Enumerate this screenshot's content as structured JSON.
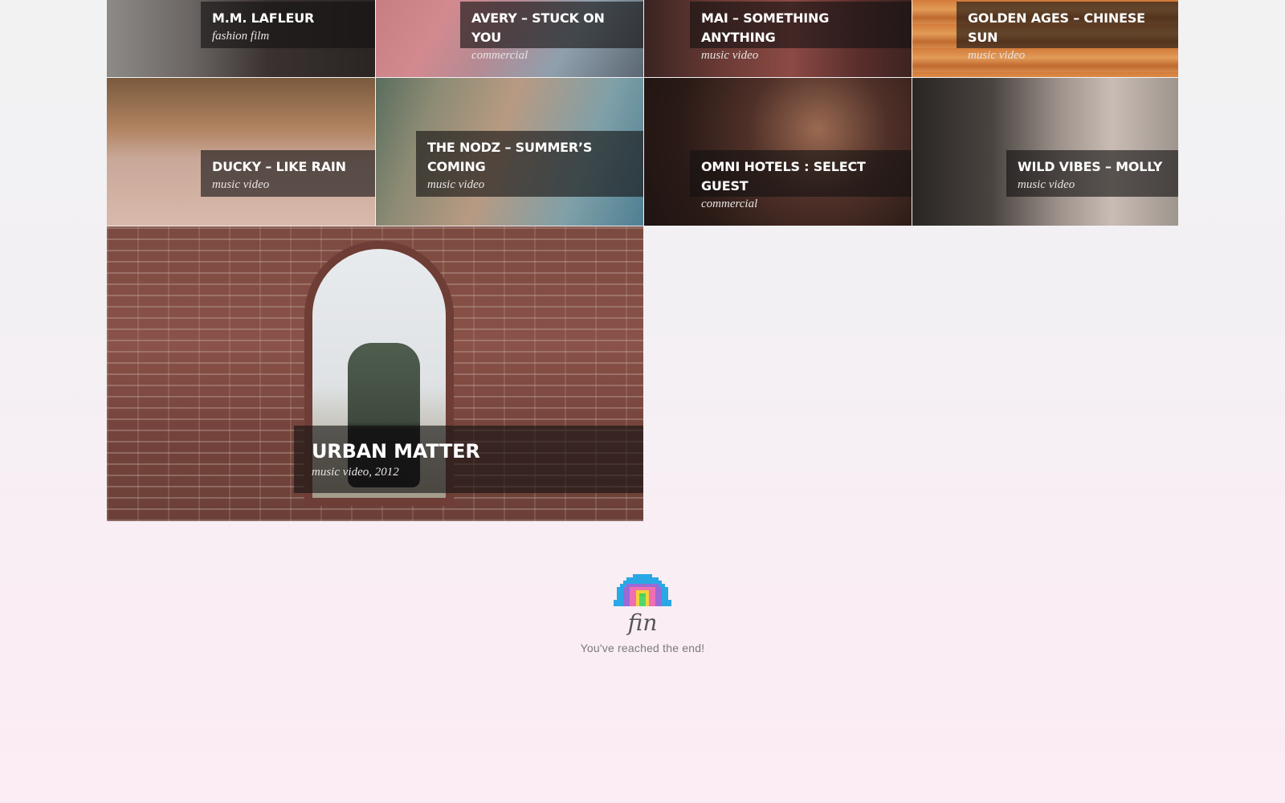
{
  "tiles": [
    {
      "title": "M.M. LAFLEUR",
      "subtitle": "fashion film"
    },
    {
      "title": "AVERY – STUCK ON YOU",
      "subtitle": "commercial"
    },
    {
      "title": "MAI – SOMETHING ANYTHING",
      "subtitle": "music video"
    },
    {
      "title": "GOLDEN AGES – CHINESE SUN",
      "subtitle": "music video"
    },
    {
      "title": "DUCKY – LIKE RAIN",
      "subtitle": "music video"
    },
    {
      "title": "THE NODZ – SUMMER’S COMING",
      "subtitle": "music video"
    },
    {
      "title": "OMNI HOTELS : SELECT GUEST",
      "subtitle": "commercial"
    },
    {
      "title": "WILD VIBES – MOLLY",
      "subtitle": "music video"
    },
    {
      "title": "URBAN MATTER",
      "subtitle": "music video, 2012"
    }
  ],
  "footer": {
    "fin": "fin",
    "message": "You've reached the end!",
    "icon": "rainbow-icon"
  }
}
